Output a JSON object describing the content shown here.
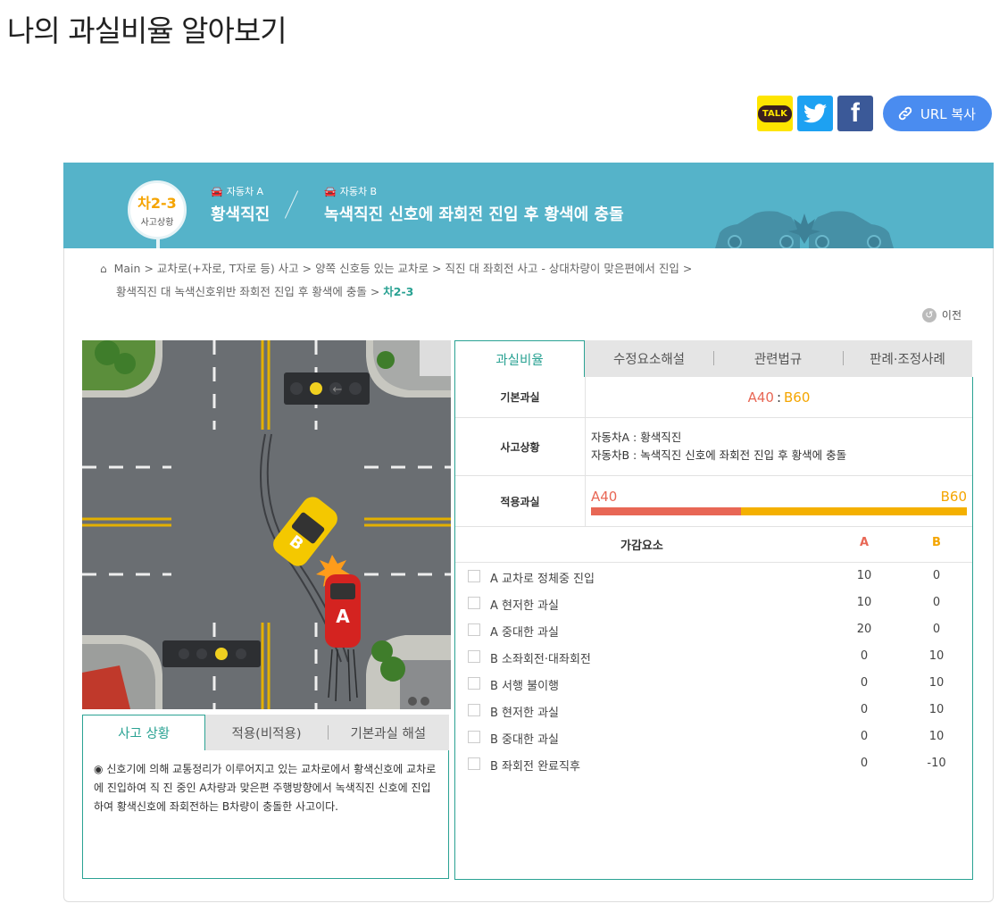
{
  "page": {
    "title": "나의 과실비율 알아보기"
  },
  "share": {
    "kakao_label": "TALK",
    "url_copy_label": "URL 복사"
  },
  "banner": {
    "code": "차2-3",
    "code_sub": "사고상황",
    "vehicle_a_label": "자동차 A",
    "vehicle_a_desc": "황색직진",
    "vehicle_b_label": "자동차 B",
    "vehicle_b_desc": "녹색직진 신호에 좌회전 진입 후 황색에 충돌"
  },
  "breadcrumb": {
    "items": [
      "Main",
      "교차로(+자로, T자로 등) 사고",
      "양쪽 신호등 있는 교차로",
      "직진 대 좌회전 사고 - 상대차량이 맞은편에서 진입",
      "황색직진 대 녹색신호위반 좌회전 진입 후 황색에 충돌"
    ],
    "current": "차2-3",
    "separator": ">",
    "home_icon": "⌂"
  },
  "prev_label": "이전",
  "scene": {
    "car_a_label": "A",
    "car_b_label": "B",
    "arrow_glyph": "←"
  },
  "left_tabs": [
    "사고 상황",
    "적용(비적용)",
    "기본과실 해설"
  ],
  "left_content": {
    "bullet": "◉",
    "text": "신호기에 의해 교통정리가 이루어지고 있는 교차로에서 황색신호에 교차로에 진입하여 직 진 중인 A차량과 맞은편 주행방향에서 녹색직진 신호에 진입하여 황색신호에 좌회전하는 B차량이 충돌한 사고이다."
  },
  "right_tabs": [
    "과실비율",
    "수정요소해설",
    "관련법규",
    "판례·조정사례"
  ],
  "fault": {
    "base_label": "기본과실",
    "base_a": "A40",
    "colon": ":",
    "base_b": "B60",
    "situation_label": "사고상황",
    "situation_a": "자동차A : 황색직진",
    "situation_b": "자동차B : 녹색직진 신호에 좌회전 진입 후 황색에 충돌",
    "applied_label": "적용과실",
    "applied_a": "A40",
    "applied_b": "B60",
    "ratio_a": 40
  },
  "factors": {
    "header": "가감요소",
    "col_a": "A",
    "col_b": "B",
    "rows": [
      {
        "name": "A 교차로 정체중 진입",
        "a": "10",
        "b": "0"
      },
      {
        "name": "A 현저한 과실",
        "a": "10",
        "b": "0"
      },
      {
        "name": "A 중대한 과실",
        "a": "20",
        "b": "0"
      },
      {
        "name": "B 소좌회전·대좌회전",
        "a": "0",
        "b": "10"
      },
      {
        "name": "B 서행 불이행",
        "a": "0",
        "b": "10"
      },
      {
        "name": "B 현저한 과실",
        "a": "0",
        "b": "10"
      },
      {
        "name": "B 중대한 과실",
        "a": "0",
        "b": "10"
      },
      {
        "name": "B 좌회전 완료직후",
        "a": "0",
        "b": "-10"
      }
    ]
  },
  "colors": {
    "banner": "#55b3c9",
    "accent": "#2aa293",
    "a": "#e86755",
    "b": "#f4a500"
  }
}
